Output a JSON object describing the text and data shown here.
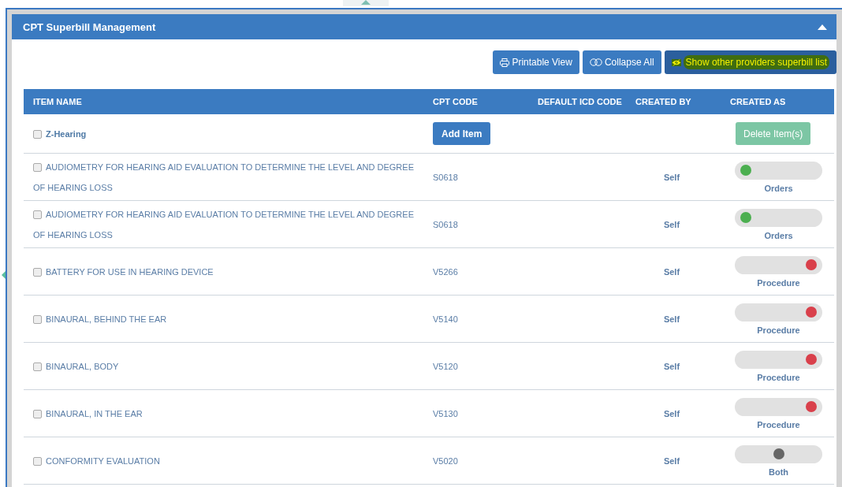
{
  "panel": {
    "title": "CPT Superbill Management",
    "collapsed": false
  },
  "toolbar": [
    {
      "label": "Printable View",
      "kind": "print",
      "highlighted": false
    },
    {
      "label": "Collapse All",
      "kind": "collapse",
      "highlighted": false
    },
    {
      "label": "Show other providers superbill list",
      "kind": "eye",
      "highlighted": true
    }
  ],
  "table": {
    "columns": [
      "ITEM NAME",
      "CPT CODE",
      "DEFAULT ICD CODE",
      "CREATED BY",
      "CREATED AS"
    ],
    "group": {
      "name": "Z-Hearing",
      "checked": false,
      "add_button": "Add Item",
      "delete_button": "Delete Item(s)",
      "delete_disabled": true
    },
    "rows": [
      {
        "name": "AUDIOMETRY FOR HEARING AID EVALUATION TO DETERMINE THE LEVEL AND DEGREE OF HEARING LOSS",
        "checked": false,
        "cpt": "S0618",
        "created_by": "Self",
        "kind": "left",
        "color": "#4caf50",
        "created_as": "Orders"
      },
      {
        "name": "AUDIOMETRY FOR HEARING AID EVALUATION TO DETERMINE THE LEVEL AND DEGREE OF HEARING LOSS",
        "checked": false,
        "cpt": "S0618",
        "created_by": "Self",
        "kind": "left",
        "color": "#4caf50",
        "created_as": "Orders"
      },
      {
        "name": "BATTERY FOR USE IN HEARING DEVICE",
        "checked": false,
        "cpt": "V5266",
        "created_by": "Self",
        "kind": "right",
        "color": "#d9404b",
        "created_as": "Procedure"
      },
      {
        "name": "BINAURAL, BEHIND THE EAR",
        "checked": false,
        "cpt": "V5140",
        "created_by": "Self",
        "kind": "right",
        "color": "#d9404b",
        "created_as": "Procedure"
      },
      {
        "name": "BINAURAL, BODY",
        "checked": false,
        "cpt": "V5120",
        "created_by": "Self",
        "kind": "right",
        "color": "#d9404b",
        "created_as": "Procedure"
      },
      {
        "name": "BINAURAL, IN THE EAR",
        "checked": false,
        "cpt": "V5130",
        "created_by": "Self",
        "kind": "right",
        "color": "#d9404b",
        "created_as": "Procedure"
      },
      {
        "name": "CONFORMITY EVALUATION",
        "checked": false,
        "cpt": "V5020",
        "created_by": "Self",
        "kind": "center",
        "color": "#666666",
        "created_as": "Both"
      }
    ]
  }
}
